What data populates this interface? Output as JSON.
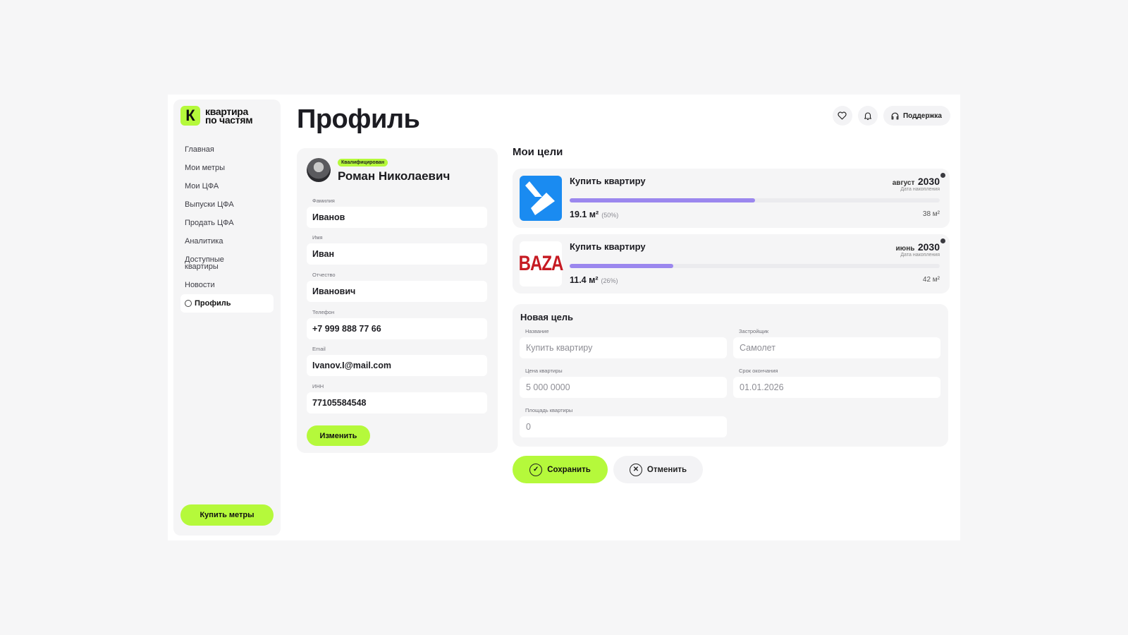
{
  "logo": {
    "mark": "К",
    "line1": "квартира",
    "line2": "по частям"
  },
  "sidebar": {
    "items": [
      {
        "label": "Главная"
      },
      {
        "label": "Мои метры"
      },
      {
        "label": "Мои ЦФА"
      },
      {
        "label": "Выпуски ЦФА"
      },
      {
        "label": "Продать ЦФА"
      },
      {
        "label": "Аналитика"
      },
      {
        "label": "Доступные квартиры"
      },
      {
        "label": "Новости"
      },
      {
        "label": "Профиль",
        "active": true,
        "icon": "user-circle-icon"
      }
    ],
    "buy_button": "Купить метры"
  },
  "header": {
    "title": "Профиль",
    "support_label": "Поддержка",
    "icons": [
      "heart-icon",
      "bell-icon",
      "headset-icon"
    ]
  },
  "profile": {
    "badge": "Квалифицирован",
    "name": "Роман Николаевич",
    "fields": [
      {
        "label": "Фамилия",
        "value": "Иванов"
      },
      {
        "label": "Имя",
        "value": "Иван"
      },
      {
        "label": "Отчество",
        "value": "Иванович"
      },
      {
        "label": "Телефон",
        "value": "+7 999 888 77 66"
      },
      {
        "label": "Email",
        "value": "Ivanov.I@mail.com"
      },
      {
        "label": "ИНН",
        "value": "77105584548"
      }
    ],
    "edit_button": "Изменить"
  },
  "goals": {
    "title": "Мои цели",
    "items": [
      {
        "title": "Купить квартиру",
        "month": "август",
        "year": "2030",
        "date_caption": "Дата накопления",
        "progress": 0.5,
        "amount": "19.1 м²",
        "percent": "(50%)",
        "total": "38 м²",
        "logo": "samolet-logo",
        "accent": "#1a8bf1"
      },
      {
        "title": "Купить квартиру",
        "month": "июнь",
        "year": "2030",
        "date_caption": "Дата накопления",
        "progress": 0.28,
        "amount": "11.4 м²",
        "percent": "(26%)",
        "total": "42 м²",
        "logo": "baza-logo",
        "logo_text": "BAZA",
        "accent": "#c61a22"
      }
    ]
  },
  "new_goal": {
    "title": "Новая цель",
    "fields": {
      "name": {
        "label": "Название",
        "placeholder": "Купить квартиру"
      },
      "developer": {
        "label": "Застройщик",
        "placeholder": "Самолет"
      },
      "price": {
        "label": "Цена квартиры",
        "placeholder": "5 000 0000"
      },
      "deadline": {
        "label": "Срок окончания",
        "placeholder": "01.01.2026"
      },
      "area": {
        "label": "Площадь квартиры",
        "placeholder": "0"
      }
    },
    "save_button": "Сохранить",
    "cancel_button": "Отменить"
  },
  "colors": {
    "accent_green": "#b5f93b",
    "progress": "#9b87ee",
    "background": "#f6f6f7"
  }
}
